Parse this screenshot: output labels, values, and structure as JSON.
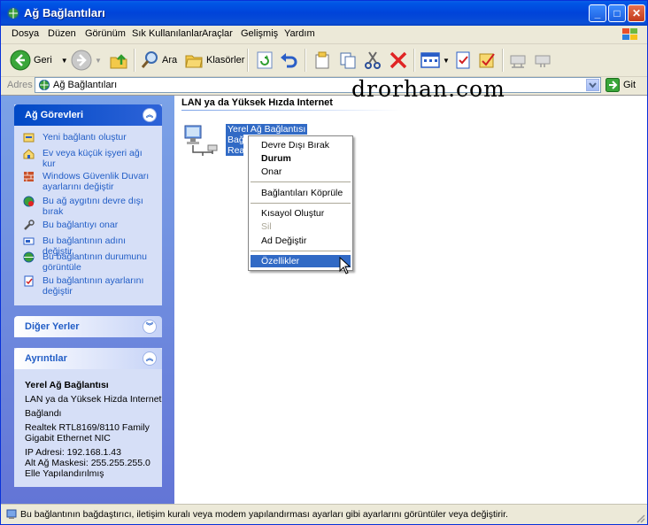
{
  "window": {
    "title": "Ağ Bağlantıları",
    "minimize": "_",
    "maximize": "□",
    "close": "✕"
  },
  "menu": [
    "Dosya",
    "Düzen",
    "Görünüm",
    "Sık Kullanılanlar",
    "Araçlar",
    "Gelişmiş",
    "Yardım"
  ],
  "toolbar": {
    "back_label": "Geri",
    "search_label": "Ara",
    "folders_label": "Klasörler"
  },
  "address": {
    "label": "Adres",
    "value": "Ağ Bağlantıları",
    "go_label": "Git"
  },
  "watermark": "drorhan.com",
  "left": {
    "tasks_title": "Ağ Görevleri",
    "tasks": [
      "Yeni bağlantı oluştur",
      "Ev veya küçük işyeri ağı kur",
      "Windows Güvenlik Duvarı ayarlarını değiştir",
      "Bu ağ aygıtını devre dışı bırak",
      "Bu bağlantıyı onar",
      "Bu bağlantının adını değiştir",
      "Bu bağlantının durumunu görüntüle",
      "Bu bağlantının ayarlarını değiştir"
    ],
    "other_title": "Diğer Yerler",
    "details_title": "Ayrıntılar",
    "details": {
      "name": "Yerel Ağ Bağlantısı",
      "type": "LAN ya da Yüksek Hizda Internet",
      "state": "Bağlandı",
      "device_line1": "Realtek RTL8169/8110 Family",
      "device_line2": "Gigabit Ethernet NIC",
      "ip": "IP Adresi: 192.168.1.43",
      "mask": "Alt Ağ Maskesi: 255.255.255.0",
      "config": "Elle Yapılandırılmış"
    }
  },
  "group_header": "LAN ya da Yüksek Hızda Internet",
  "connection": {
    "label1": "Yerel Ağ Bağlantısı",
    "label2": "Bağla",
    "label3": "Realt"
  },
  "context_menu": {
    "items": [
      {
        "label": "Devre Dışı Bırak",
        "style": "normal"
      },
      {
        "label": "Durum",
        "style": "bold"
      },
      {
        "label": "Onar",
        "style": "normal"
      },
      {
        "label": "Bağlantıları Köprüle",
        "style": "normal"
      },
      {
        "label": "Kısayol Oluştur",
        "style": "normal"
      },
      {
        "label": "Sil",
        "style": "disabled"
      },
      {
        "label": "Ad Değiştir",
        "style": "normal"
      },
      {
        "label": "Özellikler",
        "style": "highlighted"
      }
    ]
  },
  "status": {
    "text": "Bu bağlantının bağdaştırıcı, iletişim kuralı veya modem yapılandırması ayarları gibi ayarlarını görüntüler veya değiştirir."
  }
}
